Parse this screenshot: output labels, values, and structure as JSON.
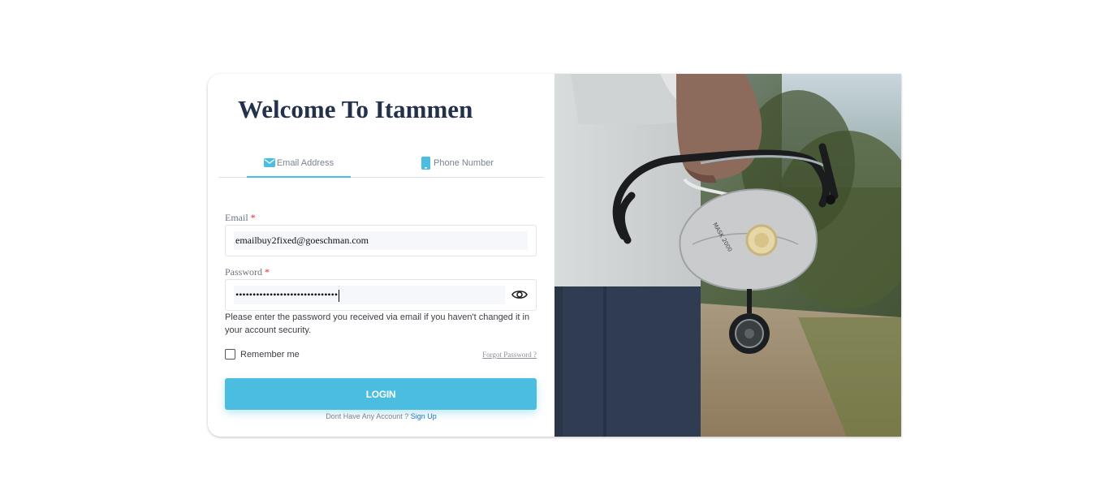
{
  "title": "Welcome To Itammen",
  "tabs": [
    {
      "label": "Email Address",
      "icon": "envelope-icon",
      "active": true
    },
    {
      "label": "Phone Number",
      "icon": "phone-icon",
      "active": false
    }
  ],
  "form": {
    "email_label": "Email",
    "email_value": "emailbuy2fixed@goeschman.com",
    "password_label": "Password",
    "password_value": "••••••••••••••••••••••••••••••",
    "required_mark": "*",
    "help_text": "Please enter the password you received via email if you haven't changed it in your account security.",
    "remember_label": "Remember me",
    "forgot_label": "Forgot Password ?",
    "login_label": "LOGIN",
    "no_account_text": "Dont Have Any Account ?",
    "signup_label": "Sign Up"
  },
  "colors": {
    "accent": "#4bbde0",
    "title": "#23324a",
    "link": "#1f6fc9",
    "required": "#e0242b"
  },
  "image": {
    "description_icon": "doctor-holding-mask-and-stethoscope-image"
  }
}
